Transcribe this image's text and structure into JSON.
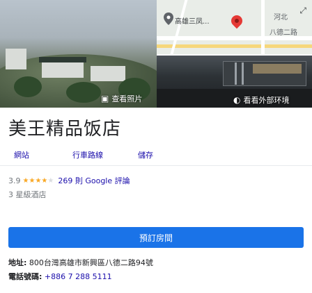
{
  "media": {
    "photos_label": "查看照片",
    "outside_label": "看看外部环境",
    "map": {
      "place_label": "高雄三凤...",
      "district_1": "河北",
      "district_2": "八德二路"
    }
  },
  "hotel": {
    "name": "美王精品饭店",
    "rating": "3.9",
    "stars_filled": 4,
    "reviews": "269 則 Google 評論",
    "hotel_class": "3 星級酒店"
  },
  "actions": {
    "website": "網站",
    "directions": "行車路線",
    "save": "儲存"
  },
  "book_label": "預訂房間",
  "details": {
    "address_label": "地址:",
    "address_value": "800台灣高雄市新興區八德二路94號",
    "phone_label": "電話號碼:",
    "phone_value": "+886 7 288 5111"
  },
  "colors": {
    "accent": "#1a73e8",
    "link": "#1a0dab",
    "star": "#f9a825"
  }
}
